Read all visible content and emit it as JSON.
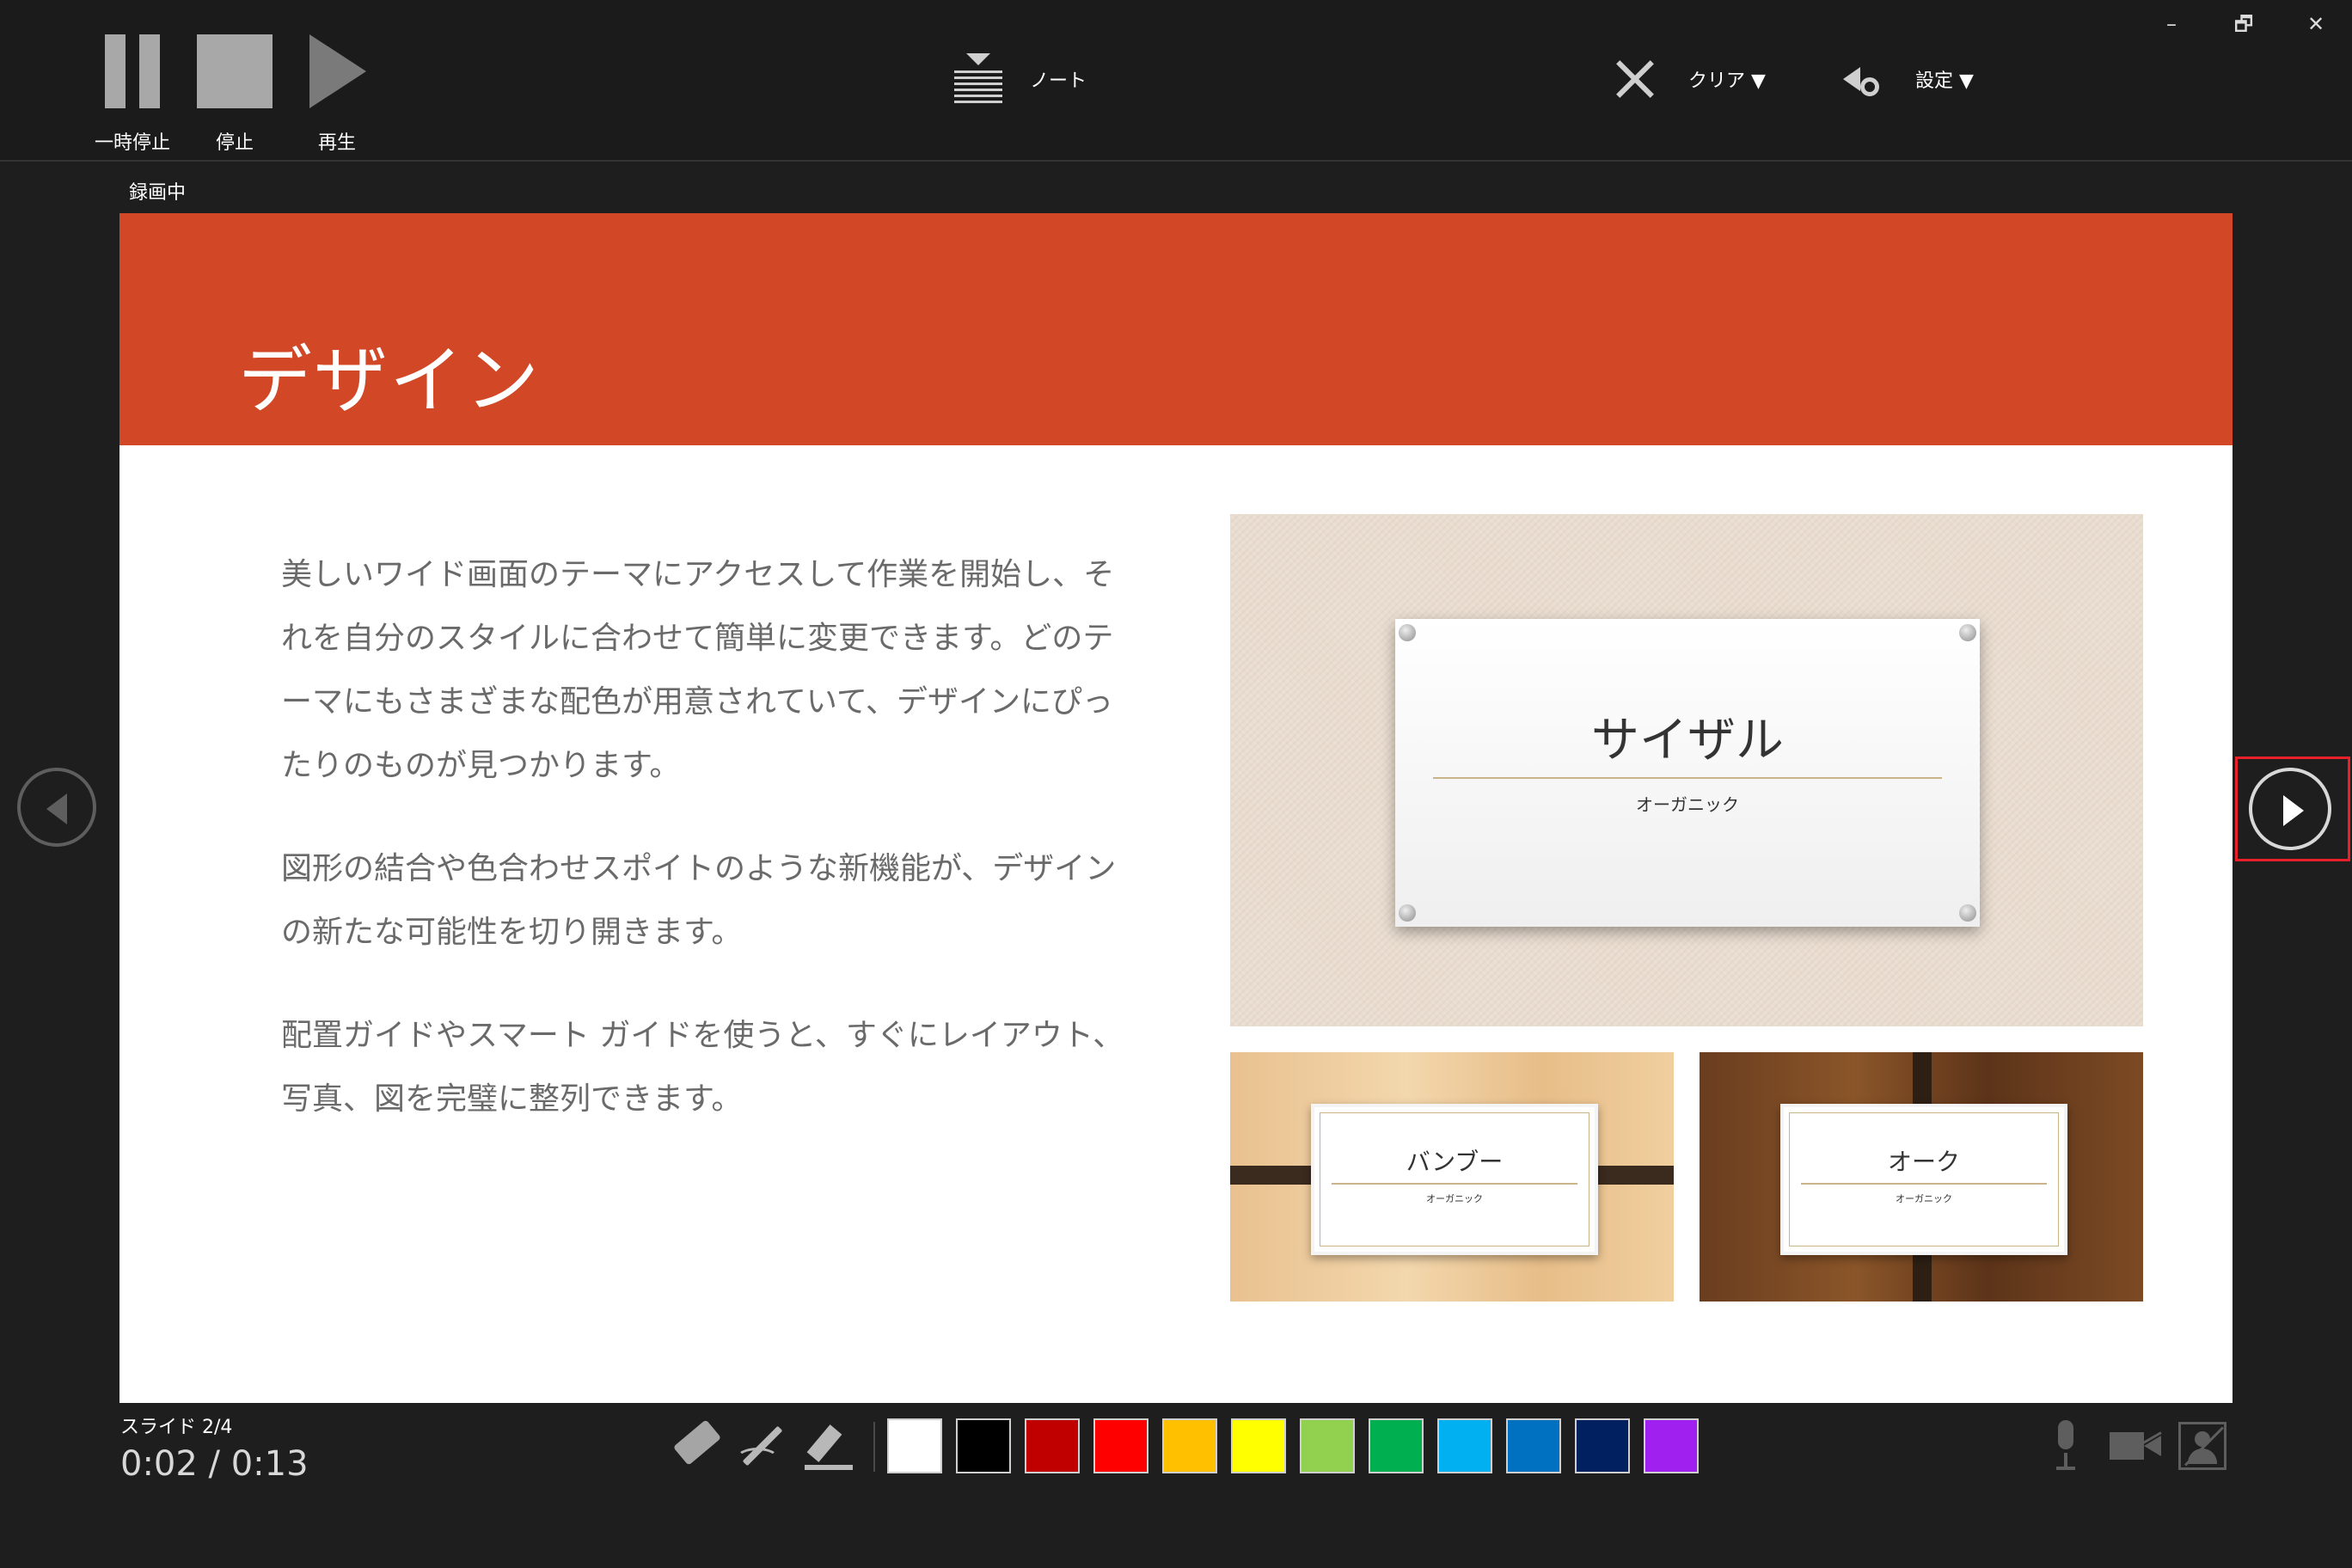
{
  "toolbar": {
    "pause_label": "一時停止",
    "stop_label": "停止",
    "play_label": "再生",
    "notes_label": "ノート",
    "clear_label": "クリア ▼",
    "settings_label": "設定 ▼",
    "recording_status": "録画中"
  },
  "window_controls": {
    "minimize": "–",
    "restore": "🗗",
    "close": "✕"
  },
  "slide": {
    "title": "デザイン",
    "paragraphs": [
      "美しいワイド画面のテーマにアクセスして作業を開始し、それを自分のスタイルに合わせて簡単に変更できます。どのテーマにもさまざまな配色が用意されていて、デザインにぴったりのものが見つかります。",
      "図形の結合や色合わせスポイトのような新機能が、デザインの新たな可能性を切り開きます。",
      "配置ガイドやスマート ガイドを使うと、すぐにレイアウト、写真、図を完璧に整列できます。"
    ],
    "theme_main": {
      "title": "サイザル",
      "subtitle": "オーガニック"
    },
    "theme_bamboo": {
      "title": "バンブー",
      "subtitle": "オーガニック"
    },
    "theme_oak": {
      "title": "オーク",
      "subtitle": "オーガニック"
    },
    "header_color": "#d24726"
  },
  "status": {
    "slide_counter": "スライド 2/4",
    "timer": "0:02 / 0:13"
  },
  "pen_colors": [
    "#ffffff",
    "#000000",
    "#c00000",
    "#ff0000",
    "#ffc000",
    "#ffff00",
    "#92d050",
    "#00b050",
    "#00b0f0",
    "#0070c0",
    "#002060",
    "#a020f0"
  ],
  "icons": {
    "pause": "pause-icon",
    "stop": "stop-icon",
    "play": "play-icon",
    "notes": "notes-icon",
    "clear": "close-icon",
    "settings": "gear-icon",
    "prev": "chevron-left-icon",
    "next": "chevron-right-icon",
    "eraser": "eraser-icon",
    "pen": "pen-icon",
    "highlighter": "highlighter-icon",
    "mic": "microphone-icon",
    "camera": "camera-icon",
    "camera_preview": "camera-preview-icon"
  }
}
